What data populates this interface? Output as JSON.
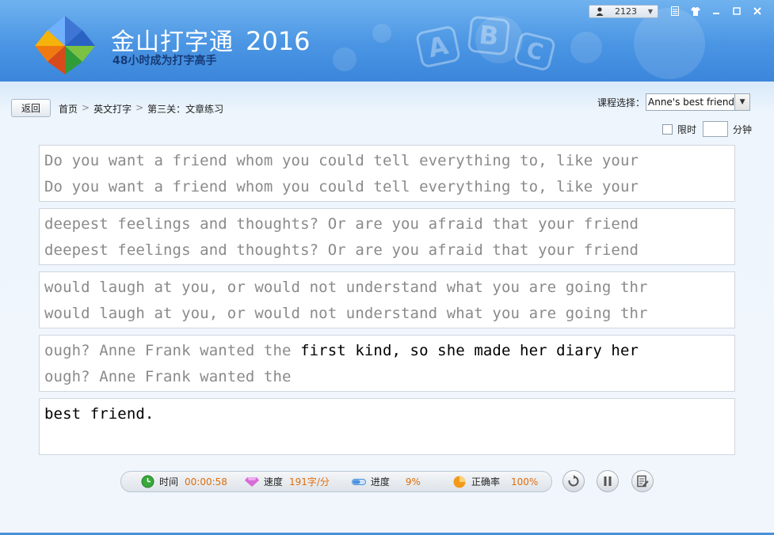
{
  "app": {
    "name": "金山打字通",
    "year": "2016",
    "slogan": "48小时成为打字高手",
    "logo_letters": [
      "A",
      "B",
      "C"
    ]
  },
  "window_controls": {
    "user_id": "2123",
    "icons": [
      "user-icon",
      "document-icon",
      "skin-icon",
      "minimize-icon",
      "maximize-icon",
      "close-icon"
    ]
  },
  "nav": {
    "back_label": "返回",
    "breadcrumb": [
      "首页",
      "英文打字",
      "第三关：文章练习"
    ],
    "separator": ">"
  },
  "course": {
    "label": "课程选择：",
    "selected": "Anne's best friend"
  },
  "time_limit": {
    "label": "限时",
    "value": "",
    "unit": "分钟"
  },
  "passage": [
    {
      "source": "Do you want a friend whom you could tell everything to, like your",
      "typed": "Do you want a friend whom you could tell everything to, like your",
      "source_done": "Do you want a friend whom you could tell everything to, like your",
      "source_rest": ""
    },
    {
      "source": "deepest feelings and thoughts? Or are you afraid that your friend",
      "typed": "deepest feelings and thoughts? Or are you afraid that your friend",
      "source_done": "deepest feelings and thoughts? Or are you afraid that your friend",
      "source_rest": ""
    },
    {
      "source": "would laugh at you, or would not understand what you are going thr",
      "typed": "would laugh at you, or would not understand what you are going thr",
      "source_done": "would laugh at you, or would not understand what you are going thr",
      "source_rest": ""
    },
    {
      "source": "ough? Anne Frank wanted the first kind, so she made her diary her",
      "typed": "ough? Anne Frank wanted the",
      "source_done": "ough? Anne Frank wanted the ",
      "source_rest": "first kind, so she made her diary her"
    },
    {
      "source": "best friend.",
      "typed": "",
      "source_done": "",
      "source_rest": "best friend."
    }
  ],
  "stats": {
    "time_label": "时间",
    "time_value": "00:00:58",
    "speed_label": "速度",
    "speed_value": "191字/分",
    "progress_label": "进度",
    "progress_value": "9%",
    "accuracy_label": "正确率",
    "accuracy_value": "100%"
  },
  "controls": [
    "restart-icon",
    "pause-icon",
    "report-icon"
  ],
  "colors": {
    "header_top": "#6fb2ef",
    "header_bottom": "#3b86db",
    "typed_text": "#8a8a8a",
    "pending_text": "#000000",
    "stat_value": "#e06d0c"
  }
}
